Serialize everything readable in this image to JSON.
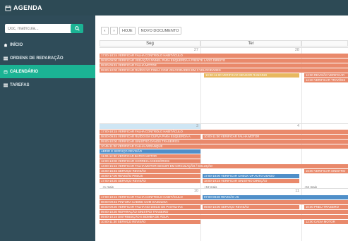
{
  "app": {
    "title": "AGENDA"
  },
  "colors": {
    "sidebar": "#2f4c59",
    "accent": "#1bb394",
    "event_orange": "#e9896b",
    "event_blue": "#4f8fc9",
    "event_yellow": "#e8b85f"
  },
  "search": {
    "placeholder": "Doc, matrícula...",
    "icon": "search-icon"
  },
  "nav": {
    "items": [
      {
        "label": "INÍCIO",
        "icon": "home-icon"
      },
      {
        "label": "ORDENS DE REPARAÇÃO",
        "icon": "list-icon"
      },
      {
        "label": "CALENDÁRIO",
        "icon": "calendar-icon"
      },
      {
        "label": "TAREFAS",
        "icon": "tasks-icon"
      }
    ]
  },
  "toolbar": {
    "prev": "‹",
    "next": "›",
    "today": "HOJE",
    "new_doc": "NOVO DOCUMENTO"
  },
  "calendar": {
    "day_headers": [
      "Seg",
      "Ter"
    ],
    "weeks": [
      {
        "days": [
          "27",
          "28"
        ],
        "events": [
          {
            "text": "17:00-18:15 VERIFICAR FALHA CONTROLO HABITÁCULO"
          },
          {
            "text": "08:00-09:00 VERIFICAR VEDAÇÃO PAINEL PARA ESQUERDA A FRENTE LADO DIREITO"
          },
          {
            "text": "09:00-09:45 VERIFICAR FALHA MOTOR"
          },
          {
            "text": "09:00-10:00 VERIFICAR RUÍDO NO PINHA COM VELOCIDADES EM 3 VELOCIDADES"
          },
          {
            "text": "10:30-11:00 VERIFICAR SENSOR RANGING"
          },
          {
            "text": "12:00 REVISÃO VERIFICAR"
          },
          {
            "text": "12:30 VERIFICAR TRAVÕES"
          }
        ]
      },
      {
        "days": [
          "3",
          "4"
        ],
        "events": [
          {
            "text": "17:00-18:15 VERIFICAR FALHA CONTROLO HABITÁCULO"
          },
          {
            "text": "08:00-09:45 VERIFICAR RUÍDO EM CURVA PARA ESQUERDA A"
          },
          {
            "text": "10:00-11:00 VERIFICAR FALHA MOTOR"
          },
          {
            "text": "09:00-10:00 VERIFICAR SINISTRO DANOS TRASEIROS"
          },
          {
            "text": "10:45-11:00 VERIFICAR CALHA ARRANQUE"
          },
          {
            "text": "ABRIR E SERVIÇO REVISÃO"
          },
          {
            "text": "11:00-12:30 VERIFICAR BATER MOTOR"
          },
          {
            "text": "12:00-13:00 VERIFICAR CORREIA ACESSÓRIOS"
          },
          {
            "text": "14:00-15:15 VERIFICAR FALHA MOTOR SEGUIR EM CIRCULAÇÃO / SOLUÇÃO"
          },
          {
            "text": "15:00-16:45 SERVIÇO REVISÃO"
          },
          {
            "text": "16:00 VERIFICAR SINISTRO"
          },
          {
            "text": "16:00-17:00 REVISÃO PNEUS"
          },
          {
            "text": "17:00-18:00 VERIFICAR CHECK UP AUTO USADO"
          },
          {
            "text": "17:00-18:30 SERVIÇO REVISÃO"
          },
          {
            "text": "18:00-19:15 VERIFICAR SINISTRO DIREÇÃO"
          },
          {
            "text": "+1 mais"
          },
          {
            "text": "+12 mais"
          },
          {
            "text": "+11 mais"
          }
        ]
      },
      {
        "days": [
          "10",
          "11"
        ],
        "events": [
          {
            "text": "17:00-18:15 VERIFICAR FALHA CONTROLO HABITÁCULO"
          },
          {
            "text": "07:00-08:30 REVISÃO A5"
          },
          {
            "text": "08:00-09:45 PINTURA CABINE COM GASOLINA"
          },
          {
            "text": "08:00-09:30 VERIFICAR FALHA NO DISCO DE PASTILHAS"
          },
          {
            "text": "09:00-10:00 SERVIÇO REVISÃO"
          },
          {
            "text": "10:00 PNEU TRASEIRO"
          },
          {
            "text": "09:00-10:30 REPARAÇÃO SINISTRO TRASEIRO"
          },
          {
            "text": "09:00-10:15 DISTRIBUIÇÃO E BOMBA DE ÁGUA"
          },
          {
            "text": "10:00-11:30 SERVIÇO REVISÃO"
          },
          {
            "text": "12:00 CAIXA MOTOR"
          }
        ]
      }
    ]
  }
}
